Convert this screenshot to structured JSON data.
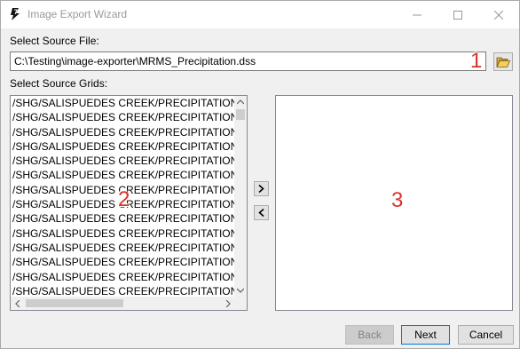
{
  "window": {
    "title": "Image Export Wizard",
    "app_icon": "wizard-app-icon"
  },
  "source_file": {
    "label": "Select Source File:",
    "value": "C:\\Testing\\image-exporter\\MRMS_Precipitation.dss",
    "browse_icon": "folder-open-icon"
  },
  "source_grids": {
    "label": "Select Source Grids:",
    "items": [
      "/SHG/SALISPUEDES CREEK/PRECIPITATION/:",
      "/SHG/SALISPUEDES CREEK/PRECIPITATION/(",
      "/SHG/SALISPUEDES CREEK/PRECIPITATION/(",
      "/SHG/SALISPUEDES CREEK/PRECIPITATION/(",
      "/SHG/SALISPUEDES CREEK/PRECIPITATION/(",
      "/SHG/SALISPUEDES CREEK/PRECIPITATION/(",
      "/SHG/SALISPUEDES CREEK/PRECIPITATION/(",
      "/SHG/SALISPUEDES CREEK/PRECIPITATION/(",
      "/SHG/SALISPUEDES CREEK/PRECIPITATION/(",
      "/SHG/SALISPUEDES CREEK/PRECIPITATION/(",
      "/SHG/SALISPUEDES CREEK/PRECIPITATION/(",
      "/SHG/SALISPUEDES CREEK/PRECIPITATION/(",
      "/SHG/SALISPUEDES CREEK/PRECIPITATION/(",
      "/SHG/SALISPUEDES CREEK/PRECIPITATION/("
    ]
  },
  "move_buttons": {
    "add_label": ">",
    "remove_label": "<"
  },
  "footer": {
    "back_label": "Back",
    "next_label": "Next",
    "cancel_label": "Cancel"
  },
  "annotations": {
    "a1": "1",
    "a2": "2",
    "a3": "3"
  },
  "colors": {
    "annotation": "#d9342b",
    "focus_border": "#0078d7"
  }
}
